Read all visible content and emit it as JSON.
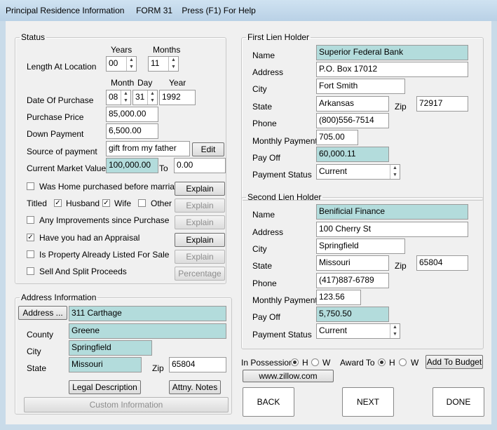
{
  "window": {
    "title": "Principal Residence Information     FORM 31    Press (F1) For Help"
  },
  "status": {
    "legend": "Status",
    "years_header": "Years",
    "months_header": "Months",
    "length_label": "Length At Location",
    "length_years": "00",
    "length_months": "11",
    "month_header": "Month",
    "day_header": "Day",
    "year_header": "Year",
    "purchase_date_label": "Date Of Purchase",
    "purchase_month": "08",
    "purchase_day": "31",
    "purchase_year": "1992",
    "purchase_price_label": "Purchase Price",
    "purchase_price": "85,000.00",
    "down_payment_label": "Down Payment",
    "down_payment": "6,500.00",
    "source_label": "Source of payment",
    "source_value": "gift from my father",
    "edit_button": "Edit",
    "market_value_label": "Current Market Value",
    "market_value": "100,000.00",
    "to_label": "To",
    "market_value_to": "0.00",
    "before_marriage_label": "Was Home purchased before marriage",
    "explain1": "Explain",
    "titled_label": "Titled",
    "husband_label": "Husband",
    "wife_label": "Wife",
    "other_label": "Other",
    "explain2": "Explain",
    "improvements_label": "Any Improvements since Purchase",
    "explain3": "Explain",
    "appraisal_label": "Have you had an Appraisal",
    "explain4": "Explain",
    "listed_label": "Is Property Already Listed For Sale",
    "explain5": "Explain",
    "sell_split_label": "Sell And Split Proceeds",
    "percentage_button": "Percentage"
  },
  "address": {
    "legend": "Address Information",
    "address_button": "Address ...",
    "street": "311 Carthage",
    "county_label": "County",
    "county": "Greene",
    "city_label": "City",
    "city": "Springfield",
    "state_label": "State",
    "state": "Missouri",
    "zip_label": "Zip",
    "zip": "65804",
    "legal_button": "Legal Description",
    "notes_button": "Attny. Notes",
    "custom_button": "Custom Information"
  },
  "first_lien": {
    "legend": "First Lien Holder",
    "name_label": "Name",
    "name": "Superior Federal Bank",
    "address_label": "Address",
    "address": "P.O. Box 17012",
    "city_label": "City",
    "city": "Fort Smith",
    "state_label": "State",
    "state": "Arkansas",
    "zip_label": "Zip",
    "zip": "72917",
    "phone_label": "Phone",
    "phone": "(800)556-7514",
    "monthly_label": "Monthly Payment",
    "monthly": "705.00",
    "payoff_label": "Pay Off",
    "payoff": "60,000.11",
    "pstatus_label": "Payment Status",
    "pstatus": "Current"
  },
  "second_lien": {
    "legend": "Second Lien Holder",
    "name_label": "Name",
    "name": "Benificial Finance",
    "address_label": "Address",
    "address": "100 Cherry St",
    "city_label": "City",
    "city": "Springfield",
    "state_label": "State",
    "state": "Missouri",
    "zip_label": "Zip",
    "zip": "65804",
    "phone_label": "Phone",
    "phone": "(417)887-6789",
    "monthly_label": "Monthly Payment",
    "monthly": "123.56",
    "payoff_label": "Pay Off",
    "payoff": "5,750.50",
    "pstatus_label": "Payment Status",
    "pstatus": "Current"
  },
  "possession": {
    "label": "In Possession",
    "h": "H",
    "w": "W",
    "award_label": "Award To",
    "award_h": "H",
    "award_w": "W",
    "budget_button": "Add To Budget",
    "zillow_button": "www.zillow.com"
  },
  "nav": {
    "back": "BACK",
    "next": "NEXT",
    "done": "DONE"
  },
  "colors": {
    "highlight_field": "#b3dcdc",
    "window_frame": "#c9dbe9"
  }
}
